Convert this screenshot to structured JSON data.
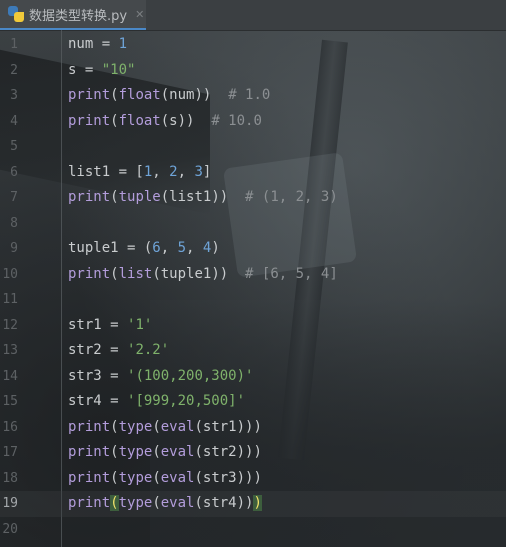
{
  "tab": {
    "filename": "数据类型转换.py",
    "close_glyph": "✕"
  },
  "colors": {
    "accent": "#4a88c7",
    "builtin": "#b39ddb",
    "number": "#6fa4d8",
    "string": "#7fb26b",
    "comment": "#8b8f92"
  },
  "editor": {
    "current_line": 19,
    "lines": [
      {
        "n": "1",
        "tokens": [
          [
            "p",
            "num = "
          ],
          [
            "n",
            "1"
          ]
        ]
      },
      {
        "n": "2",
        "tokens": [
          [
            "p",
            "s = "
          ],
          [
            "s",
            "\"10\""
          ]
        ]
      },
      {
        "n": "3",
        "tokens": [
          [
            "k",
            "print"
          ],
          [
            "p",
            "("
          ],
          [
            "k",
            "float"
          ],
          [
            "p",
            "(num))  "
          ],
          [
            "c",
            "# 1.0"
          ]
        ]
      },
      {
        "n": "4",
        "tokens": [
          [
            "k",
            "print"
          ],
          [
            "p",
            "("
          ],
          [
            "k",
            "float"
          ],
          [
            "p",
            "(s))  "
          ],
          [
            "c",
            "# 10.0"
          ]
        ]
      },
      {
        "n": "5",
        "tokens": []
      },
      {
        "n": "6",
        "tokens": [
          [
            "p",
            "list1 = ["
          ],
          [
            "n",
            "1"
          ],
          [
            "p",
            ", "
          ],
          [
            "n",
            "2"
          ],
          [
            "p",
            ", "
          ],
          [
            "n",
            "3"
          ],
          [
            "p",
            "]"
          ]
        ]
      },
      {
        "n": "7",
        "tokens": [
          [
            "k",
            "print"
          ],
          [
            "p",
            "("
          ],
          [
            "k",
            "tuple"
          ],
          [
            "p",
            "(list1))  "
          ],
          [
            "c",
            "# (1, 2, 3)"
          ]
        ]
      },
      {
        "n": "8",
        "tokens": []
      },
      {
        "n": "9",
        "tokens": [
          [
            "p",
            "tuple1 = ("
          ],
          [
            "n",
            "6"
          ],
          [
            "p",
            ", "
          ],
          [
            "n",
            "5"
          ],
          [
            "p",
            ", "
          ],
          [
            "n",
            "4"
          ],
          [
            "p",
            ")"
          ]
        ]
      },
      {
        "n": "10",
        "tokens": [
          [
            "k",
            "print"
          ],
          [
            "p",
            "("
          ],
          [
            "k",
            "list"
          ],
          [
            "p",
            "(tuple1))  "
          ],
          [
            "c",
            "# [6, 5, 4]"
          ]
        ]
      },
      {
        "n": "11",
        "tokens": []
      },
      {
        "n": "12",
        "tokens": [
          [
            "p",
            "str1 = "
          ],
          [
            "s",
            "'1'"
          ]
        ]
      },
      {
        "n": "13",
        "tokens": [
          [
            "p",
            "str2 = "
          ],
          [
            "s",
            "'2.2'"
          ]
        ]
      },
      {
        "n": "14",
        "tokens": [
          [
            "p",
            "str3 = "
          ],
          [
            "s",
            "'(100,200,300)'"
          ]
        ]
      },
      {
        "n": "15",
        "tokens": [
          [
            "p",
            "str4 = "
          ],
          [
            "s",
            "'[999,20,500]'"
          ]
        ]
      },
      {
        "n": "16",
        "tokens": [
          [
            "k",
            "print"
          ],
          [
            "p",
            "("
          ],
          [
            "k",
            "type"
          ],
          [
            "p",
            "("
          ],
          [
            "k",
            "eval"
          ],
          [
            "p",
            "(str1)))"
          ]
        ]
      },
      {
        "n": "17",
        "tokens": [
          [
            "k",
            "print"
          ],
          [
            "p",
            "("
          ],
          [
            "k",
            "type"
          ],
          [
            "p",
            "("
          ],
          [
            "k",
            "eval"
          ],
          [
            "p",
            "(str2)))"
          ]
        ]
      },
      {
        "n": "18",
        "tokens": [
          [
            "k",
            "print"
          ],
          [
            "p",
            "("
          ],
          [
            "k",
            "type"
          ],
          [
            "p",
            "("
          ],
          [
            "k",
            "eval"
          ],
          [
            "p",
            "(str3)))"
          ]
        ]
      },
      {
        "n": "19",
        "tokens": [
          [
            "k",
            "print"
          ],
          [
            "match",
            "("
          ],
          [
            "k",
            "type"
          ],
          [
            "p",
            "("
          ],
          [
            "k",
            "eval"
          ],
          [
            "p",
            "(str4))"
          ],
          [
            "match",
            ")"
          ]
        ]
      },
      {
        "n": "20",
        "tokens": []
      }
    ]
  }
}
